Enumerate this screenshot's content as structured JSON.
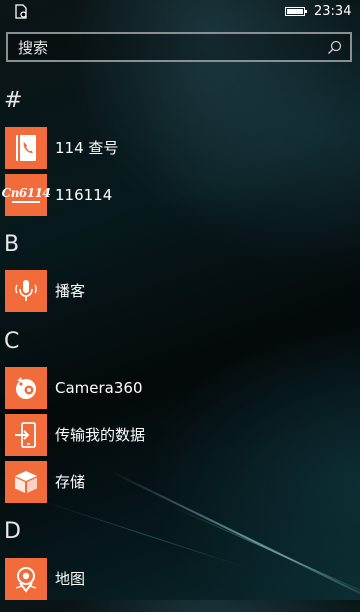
{
  "status_bar": {
    "left_icon": "notification-clipboard-icon",
    "battery_icon": "battery-icon",
    "time": "23:34"
  },
  "search": {
    "placeholder": "搜索",
    "icon": "search-icon"
  },
  "sections": [
    {
      "letter": "#",
      "apps": [
        {
          "name": "114 查号",
          "icon": "phone-book-icon",
          "tile_color": "#f26b3a"
        },
        {
          "name": "116114",
          "icon": "116114-logo-icon",
          "logo_text": "Cn6114",
          "tile_color": "#f26b3a"
        }
      ]
    },
    {
      "letter": "B",
      "apps": [
        {
          "name": "播客",
          "icon": "podcast-microphone-icon",
          "tile_color": "#f26b3a"
        }
      ]
    },
    {
      "letter": "C",
      "apps": [
        {
          "name": "Camera360",
          "icon": "camera360-icon",
          "tile_color": "#f26b3a"
        },
        {
          "name": "传输我的数据",
          "icon": "transfer-data-icon",
          "tile_color": "#f26b3a"
        },
        {
          "name": "存储",
          "icon": "storage-box-icon",
          "tile_color": "#f26b3a"
        }
      ]
    },
    {
      "letter": "D",
      "apps": [
        {
          "name": "地图",
          "icon": "maps-icon",
          "tile_color": "#f26b3a"
        }
      ]
    }
  ]
}
